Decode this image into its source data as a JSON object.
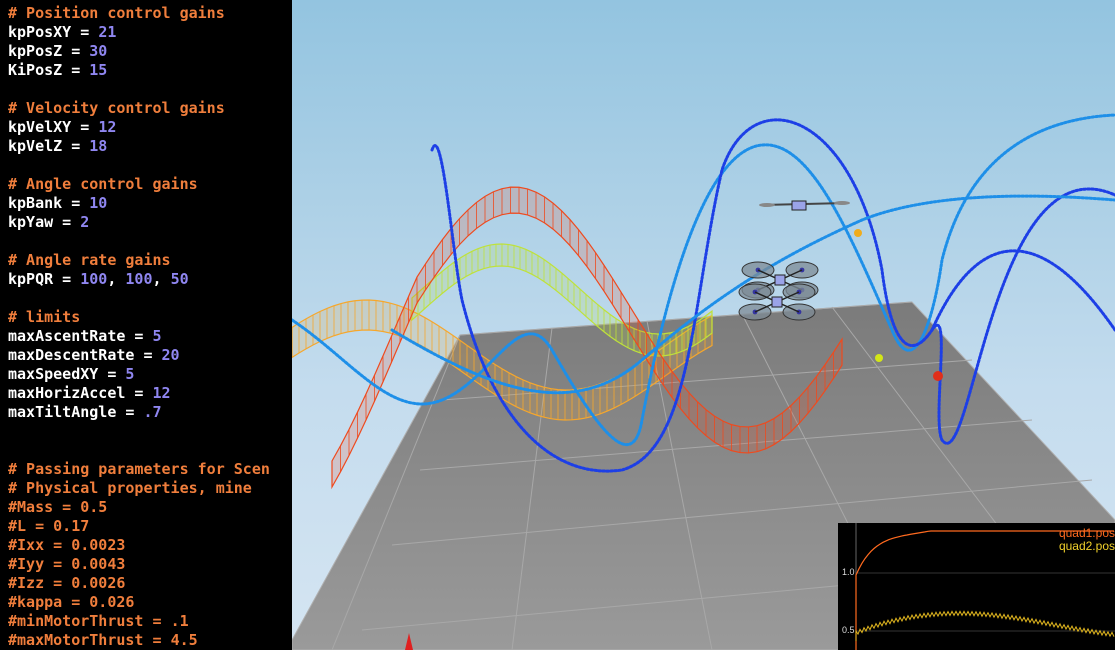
{
  "editor": {
    "colors": {
      "comment": "#f07e3c",
      "key": "#ffffff",
      "number": "#8f86f0",
      "background": "#000000"
    },
    "lines": [
      {
        "comment": "# Position control gains"
      },
      {
        "key": "kpPosXY",
        "values": [
          "21"
        ]
      },
      {
        "key": "kpPosZ",
        "values": [
          "30"
        ]
      },
      {
        "key": "KiPosZ",
        "values": [
          "15"
        ]
      },
      {},
      {
        "comment": "# Velocity control gains"
      },
      {
        "key": "kpVelXY",
        "values": [
          "12"
        ]
      },
      {
        "key": "kpVelZ",
        "values": [
          "18"
        ]
      },
      {},
      {
        "comment": "# Angle control gains"
      },
      {
        "key": "kpBank",
        "values": [
          "10"
        ]
      },
      {
        "key": "kpYaw",
        "values": [
          "2"
        ]
      },
      {},
      {
        "comment": "# Angle rate gains"
      },
      {
        "key": "kpPQR",
        "values": [
          "100",
          "100",
          "50"
        ]
      },
      {},
      {
        "comment": "# limits"
      },
      {
        "key": "maxAscentRate",
        "values": [
          "5"
        ]
      },
      {
        "key": "maxDescentRate",
        "values": [
          "20"
        ]
      },
      {
        "key": "maxSpeedXY",
        "values": [
          "5"
        ]
      },
      {
        "key": "maxHorizAccel",
        "values": [
          "12"
        ]
      },
      {
        "key": "maxTiltAngle",
        "values": [
          ".7"
        ]
      },
      {},
      {},
      {
        "comment": "# Passing parameters for Scen"
      },
      {
        "comment": "# Physical properties, mine"
      },
      {
        "key": "#Mass",
        "values": [
          "0.5"
        ],
        "commented": true
      },
      {
        "key": "#L",
        "values": [
          "0.17"
        ],
        "commented": true
      },
      {
        "key": "#Ixx",
        "values": [
          "0.0023"
        ],
        "commented": true
      },
      {
        "key": "#Iyy",
        "values": [
          "0.0043"
        ],
        "commented": true
      },
      {
        "key": "#Izz",
        "values": [
          "0.0026"
        ],
        "commented": true
      },
      {
        "key": "#kappa",
        "values": [
          "0.026"
        ],
        "commented": true
      },
      {
        "key": "#minMotorThrust",
        "values": [
          ".1"
        ],
        "commented": true
      },
      {
        "key": "#maxMotorThrust",
        "values": [
          "4.5"
        ],
        "commented": true
      }
    ]
  },
  "scene": {
    "sky_top": "#93c4e0",
    "sky_bottom": "#d5e5f2",
    "floor_color": "#8a8a8a",
    "ribbon_colors": [
      "#ef4a1e",
      "#f6a72c",
      "#bfe23a"
    ],
    "trajectory_colors": [
      "#1d3fe6",
      "#1e8fe8"
    ],
    "marker_colors": [
      "#f0ac1c",
      "#d3e617",
      "#e02f1a"
    ]
  },
  "plot": {
    "legend": [
      {
        "text": "quad1.pos",
        "color": "#ff6a1f"
      },
      {
        "text": "quad2.pos",
        "color": "#f1d12b"
      }
    ],
    "yticks": [
      "1.0",
      "0.5"
    ],
    "series_colors": [
      "#ff6a1f",
      "#e2b71f"
    ]
  }
}
